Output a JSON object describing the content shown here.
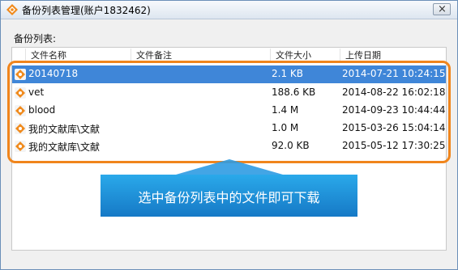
{
  "window": {
    "title": "备份列表管理(账户1832462)",
    "close_symbol": "×",
    "accent": "#3f86d8",
    "highlight_color": "#f0851c"
  },
  "section_label": "备份列表:",
  "table": {
    "columns": [
      "文件名称",
      "文件备注",
      "文件大小",
      "上传日期"
    ],
    "rows": [
      {
        "name": "20140718",
        "note": "",
        "size": "2.1 KB",
        "date": "2014-07-21 10:24:15",
        "selected": true
      },
      {
        "name": "vet",
        "note": "",
        "size": "188.6 KB",
        "date": "2014-08-22 16:02:18",
        "selected": false
      },
      {
        "name": "blood",
        "note": "",
        "size": "1.4 M",
        "date": "2014-09-23 10:44:44",
        "selected": false
      },
      {
        "name": "我的文献库\\文献",
        "note": "",
        "size": "1.0 M",
        "date": "2015-03-26 15:04:14",
        "selected": false
      },
      {
        "name": "我的文献库\\文献",
        "note": "",
        "size": "92.0 KB",
        "date": "2015-05-12 17:30:25",
        "selected": false
      }
    ]
  },
  "callout": {
    "text": "选中备份列表中的文件即可下载",
    "color": "#1e8fd8"
  },
  "icons": {
    "app": "app-logo-icon",
    "row": "backup-file-icon"
  }
}
